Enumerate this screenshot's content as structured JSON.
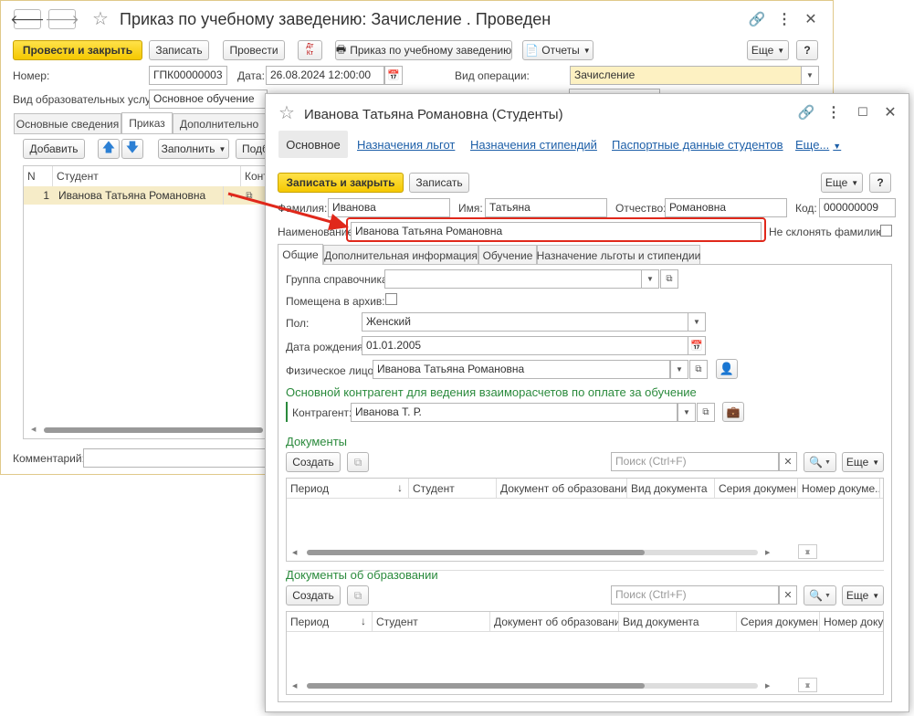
{
  "main": {
    "title": "Приказ по учебному заведению: Зачисление . Проведен",
    "toolbar": {
      "post_close": "Провести и закрыть",
      "save": "Записать",
      "post": "Провести",
      "dt_kt_top": "Дт",
      "dt_kt_bottom": "Кт",
      "print_order": "Приказ по учебному заведению",
      "reports": "Отчеты",
      "more": "Еще",
      "help": "?"
    },
    "fields": {
      "number_label": "Номер:",
      "number_value": "ГПК00000003",
      "date_label": "Дата:",
      "date_value": "26.08.2024 12:00:00",
      "operation_label": "Вид операции:",
      "operation_value": "Зачисление",
      "service_label": "Вид образовательных услуг:",
      "service_value": "Основное обучение"
    },
    "tabs": [
      "Основные сведения",
      "Приказ",
      "Дополнительно"
    ],
    "table_toolbar": {
      "add": "Добавить",
      "fill": "Заполнить",
      "select": "Подб"
    },
    "table": {
      "headers": [
        "N",
        "Студент",
        "Конт"
      ],
      "rows": [
        {
          "n": "1",
          "student": "Иванова Татьяна Романовна"
        }
      ]
    },
    "comment_label": "Комментарий:"
  },
  "dialog": {
    "title": "Иванова Татьяна Романовна (Студенты)",
    "nav": {
      "main": "Основное",
      "benefits": "Назначения льгот",
      "stipends": "Назначения стипендий",
      "passport": "Паспортные данные студентов",
      "more": "Еще..."
    },
    "toolbar": {
      "save_close": "Записать и закрыть",
      "save": "Записать",
      "more": "Еще",
      "help": "?"
    },
    "fields": {
      "surname_label": "Фамилия:",
      "surname_value": "Иванова",
      "name_label": "Имя:",
      "name_value": "Татьяна",
      "patronymic_label": "Отчество:",
      "patronymic_value": "Романовна",
      "code_label": "Код:",
      "code_value": "000000009",
      "fullname_label": "Наименование:",
      "fullname_value": "Иванова Татьяна Романовна",
      "no_decline_label": "Не склонять фамилию:"
    },
    "tabs": [
      "Общие",
      "Дополнительная информация",
      "Обучение",
      "Назначение льготы и стипендии"
    ],
    "general": {
      "group_label": "Группа справочника:",
      "archived_label": "Помещена в архив:",
      "gender_label": "Пол:",
      "gender_value": "Женский",
      "birth_label": "Дата рождения:",
      "birth_value": "01.01.2005",
      "person_label": "Физическое лицо:",
      "person_value": "Иванова Татьяна Романовна",
      "contractor_section": "Основной контрагент для ведения взаиморасчетов по оплате за обучение",
      "contractor_label": "Контрагент:",
      "contractor_value": "Иванова Т. Р."
    },
    "documents": {
      "title": "Документы",
      "create": "Создать",
      "search_placeholder": "Поиск (Ctrl+F)",
      "more": "Еще",
      "headers": [
        "Период",
        "Студент",
        "Документ об образовании",
        "Вид документа",
        "Серия докумен...",
        "Номер докуме..."
      ]
    },
    "edu_documents": {
      "title": "Документы об образовании",
      "create": "Создать",
      "search_placeholder": "Поиск (Ctrl+F)",
      "more": "Еще",
      "headers": [
        "Период",
        "Студент",
        "Документ об образовании",
        "Вид документа",
        "Серия докумен...",
        "Номер докум..."
      ]
    }
  },
  "colors": {
    "accent_yellow": "#f5c800",
    "link_blue": "#1d5fa8",
    "section_green": "#2a8a3c",
    "highlight_red": "#e0281b"
  },
  "icons": [
    "back-arrow-icon",
    "forward-arrow-icon",
    "star-icon",
    "link-icon",
    "more-vert-icon",
    "close-icon",
    "printer-icon",
    "calendar-icon",
    "up-arrow-icon",
    "down-arrow-icon",
    "maximize-icon",
    "search-icon",
    "clear-icon",
    "person-card-icon",
    "briefcase-icon",
    "sort-down-icon"
  ]
}
